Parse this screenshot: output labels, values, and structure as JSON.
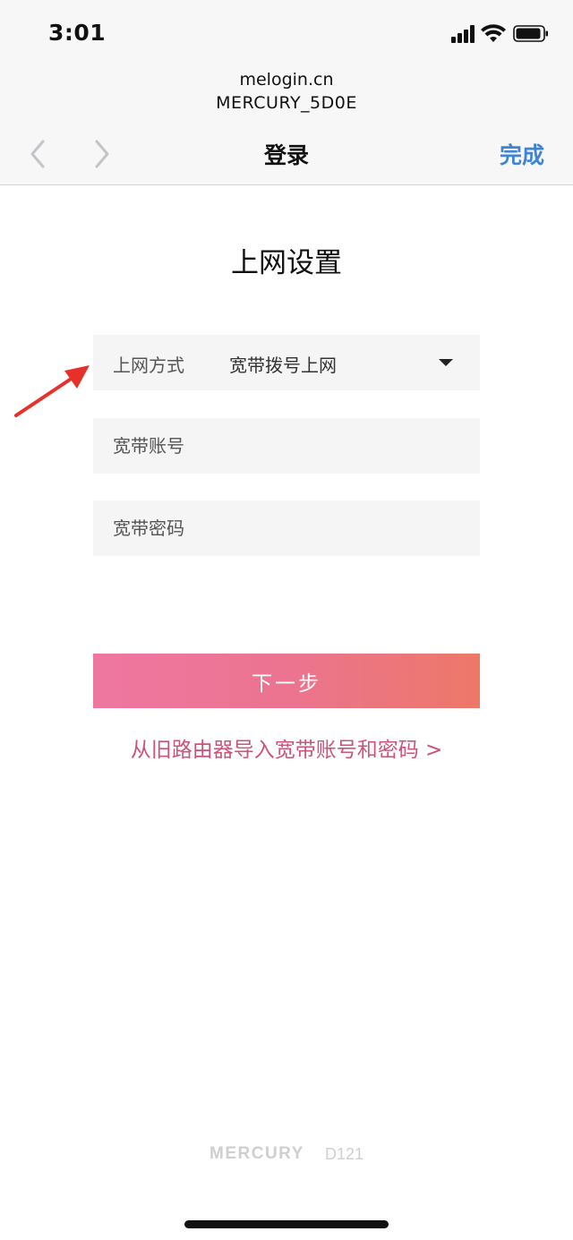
{
  "status_bar": {
    "time": "3:01",
    "signal_icon": "cellular-signal-icon",
    "wifi_icon": "wifi-icon",
    "battery_icon": "battery-icon"
  },
  "browser": {
    "url_host": "melogin.cn",
    "network_name": "MERCURY_5D0E",
    "title": "登录",
    "done_label": "完成",
    "back_icon": "chevron-left-icon",
    "forward_icon": "chevron-right-icon",
    "accent_color": "#3e85d6"
  },
  "page": {
    "heading": "上网设置",
    "connection_type": {
      "label": "上网方式",
      "value": "宽带拨号上网",
      "caret_icon": "caret-down-icon"
    },
    "account_field": {
      "placeholder": "宽带账号",
      "value": ""
    },
    "password_field": {
      "placeholder": "宽带密码",
      "value": ""
    },
    "next_button_label": "下一步",
    "import_link_label": "从旧路由器导入宽带账号和密码 >",
    "brand_color_start": "#ee77a1",
    "brand_color_end": "#ed7868"
  },
  "annotation": {
    "arrow_icon": "red-arrow-icon",
    "color": "#e8302a"
  },
  "footer": {
    "brand": "MERCURY",
    "model": "D121"
  }
}
